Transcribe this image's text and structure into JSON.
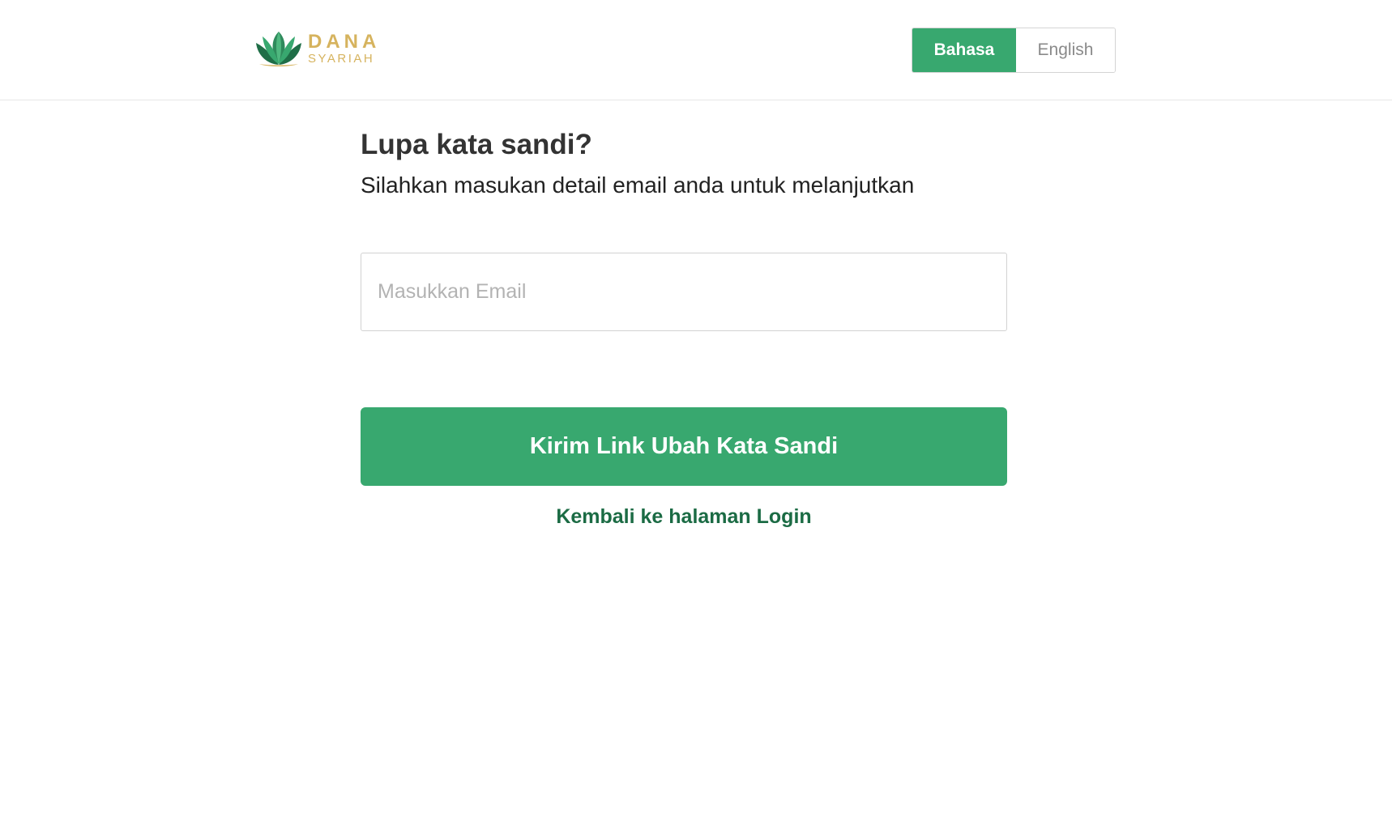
{
  "header": {
    "logo": {
      "icon": "lotus-icon",
      "word1": "DANA",
      "word2": "SYARIAH"
    },
    "language": {
      "active_label": "Bahasa",
      "inactive_label": "English"
    }
  },
  "form": {
    "title": "Lupa kata sandi?",
    "subtitle": "Silahkan masukan detail email anda untuk melanjutkan",
    "email_value": "",
    "email_placeholder": "Masukkan Email",
    "submit_label": "Kirim Link Ubah Kata Sandi",
    "back_link": "Kembali ke halaman Login"
  },
  "colors": {
    "primary": "#38a86f",
    "link": "#1b6b44",
    "logo_gold": "#d6b35e"
  }
}
